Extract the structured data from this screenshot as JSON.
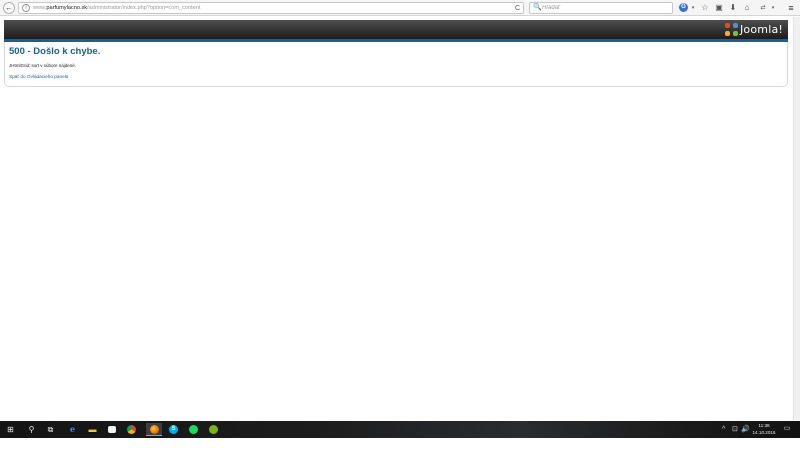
{
  "browser": {
    "url_prefix": "www.",
    "url_domain": "parfumylacno.sk",
    "url_path": "/administrator/index.php?option=com_content",
    "search_placeholder": "Hľadať",
    "icons": {
      "back": "←",
      "info": "i",
      "reload": "C",
      "search": "🔍",
      "google": "G",
      "dropdown": "▾",
      "bookmark_star": "☆",
      "clipboard": "▣",
      "download": "⬇",
      "home": "⌂",
      "extension": "⇄",
      "menu": "≡"
    }
  },
  "header": {
    "logo_text": "Joomla!"
  },
  "error": {
    "title": "500 - Došlo k chybe.",
    "message": "JHtmlGrid::sort v súbore nájdené.",
    "back_link": "Späť do Ovládacieho panela"
  },
  "taskbar": {
    "icons": {
      "start": "⊞",
      "search": "⚲",
      "task_view": "⧉",
      "edge": "e",
      "explorer": "▬",
      "store": "🛍",
      "chevron": "^",
      "network": "⊡",
      "volume": "🔊",
      "notifications": "▭"
    },
    "skype_glyph": "S",
    "clock_time": "11:38",
    "clock_date": "14.10.2016"
  },
  "colors": {
    "joomla_blue": "#1b5f93",
    "link_blue": "#1f5fa5",
    "header_dark": "#1c1c1c"
  }
}
